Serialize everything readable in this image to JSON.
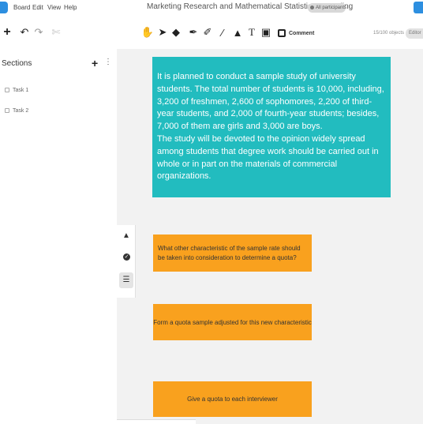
{
  "menubar": {
    "items": [
      "Board",
      "Edit",
      "View",
      "Help"
    ],
    "title": "Marketing Research and Mathematical Statistics. Sampling",
    "participants_label": "All participants"
  },
  "toolbar": {
    "icons": [
      "hand-icon",
      "pointer-icon",
      "eraser-icon",
      "pen-icon",
      "marker-icon",
      "line-icon",
      "fill-icon",
      "text-icon",
      "sticky-note-icon"
    ],
    "comment_label": "Comment",
    "object_count": "15/100 objects",
    "role_label": "Editor"
  },
  "sidebar": {
    "title": "Sections",
    "tasks": [
      {
        "label": "Task 1"
      },
      {
        "label": "Task 2"
      }
    ]
  },
  "notes": {
    "main": "It is planned to conduct a sample study of university students. The total number of students is 10,000, including, 3,200 of freshmen, 2,600 of sophomores, 2,200 of third-year students, and 2,000 of fourth-year students; besides, 7,000 of them are girls and 3,000 are boys.\nThe study will be devoted to the opinion widely spread among students that degree work should be carried out in whole or in part on the materials of commercial organizations.",
    "q1": "What other characteristic of the sample rate should be taken into consideration to determine a quota?",
    "q2": "Form a quota sample adjusted for this new characteristic",
    "q3": "Give a quota to each interviewer"
  },
  "colors": {
    "teal_note": "#22bcbf",
    "orange_note": "#f9a11e",
    "accent": "#2d8fe0"
  }
}
